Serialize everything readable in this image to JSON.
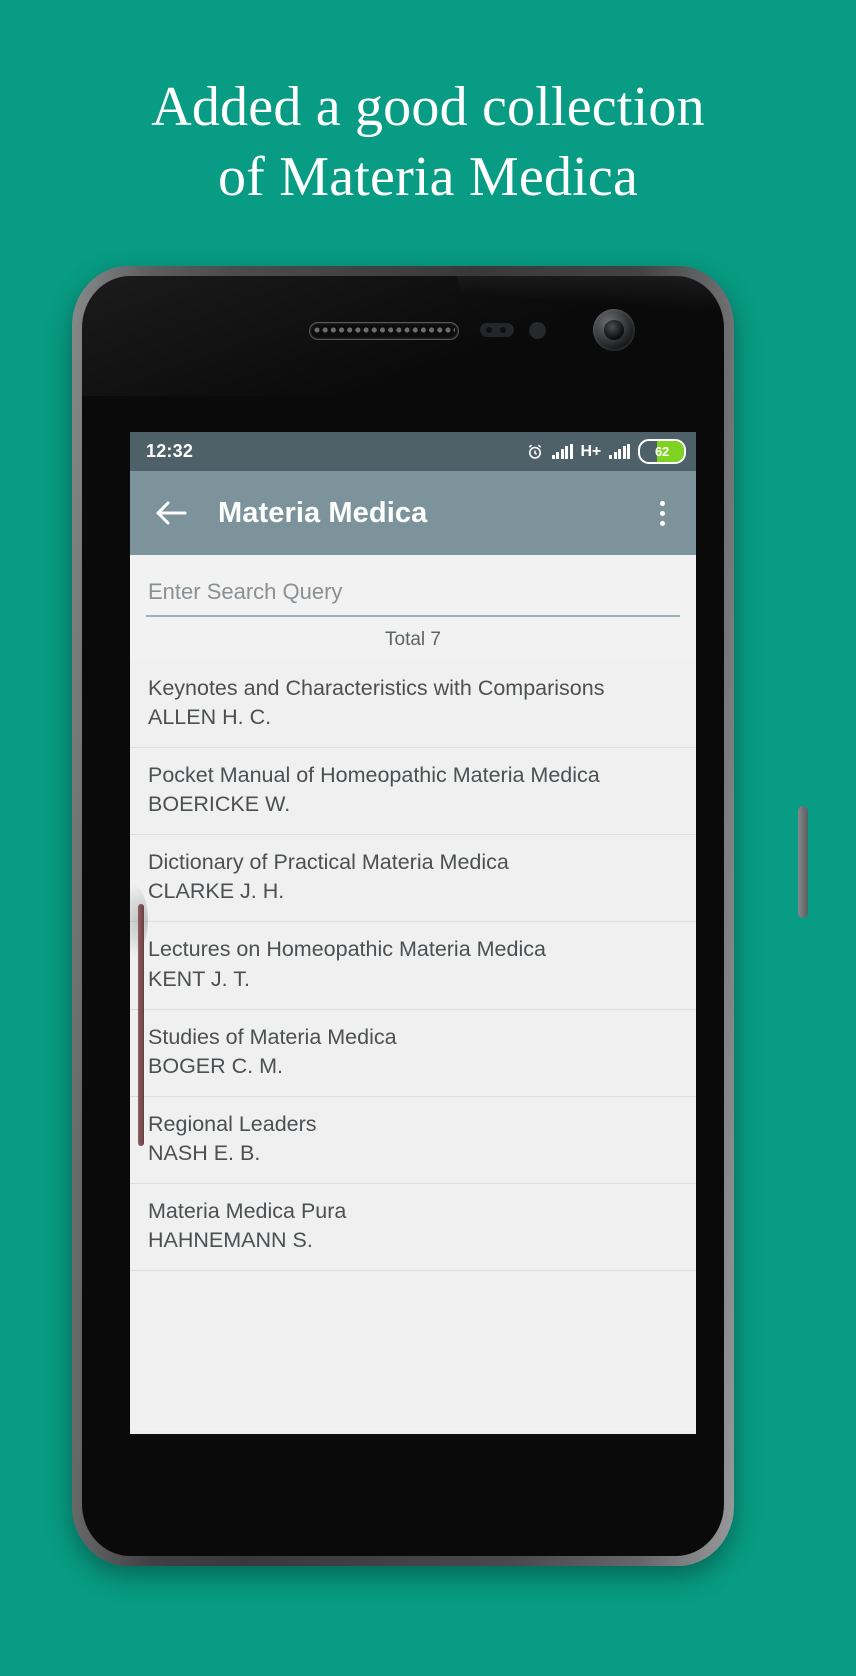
{
  "headline": {
    "line1": "Added a good collection",
    "line2": "of Materia Medica"
  },
  "colors": {
    "background_teal": "#089c84",
    "statusbar": "#4e6169",
    "appbar": "#7d939c",
    "battery_fill": "#7ed321",
    "screen_bg": "#eff0ef"
  },
  "statusbar": {
    "time": "12:32",
    "alarm_icon": "alarm-clock-icon",
    "signal_icon_1": "signal-bars-icon",
    "network_type": "H+",
    "signal_icon_2": "signal-bars-icon",
    "battery_percent": "62",
    "battery_level": 62
  },
  "appbar": {
    "back_icon": "back-arrow-icon",
    "title": "Materia Medica",
    "overflow_icon": "overflow-menu-icon"
  },
  "search": {
    "value": "",
    "placeholder": "Enter Search Query"
  },
  "list": {
    "total_label": "Total 7",
    "count": 7,
    "items": [
      {
        "title": "Keynotes and Characteristics with Comparisons",
        "author": "ALLEN H. C."
      },
      {
        "title": "Pocket Manual of Homeopathic Materia Medica",
        "author": "BOERICKE W."
      },
      {
        "title": "Dictionary of Practical Materia Medica",
        "author": "CLARKE J. H."
      },
      {
        "title": "Lectures on Homeopathic Materia Medica",
        "author": "KENT J. T."
      },
      {
        "title": "Studies of Materia Medica",
        "author": "BOGER C. M."
      },
      {
        "title": "Regional Leaders",
        "author": "NASH E. B."
      },
      {
        "title": "Materia Medica Pura",
        "author": "HAHNEMANN S."
      }
    ]
  }
}
